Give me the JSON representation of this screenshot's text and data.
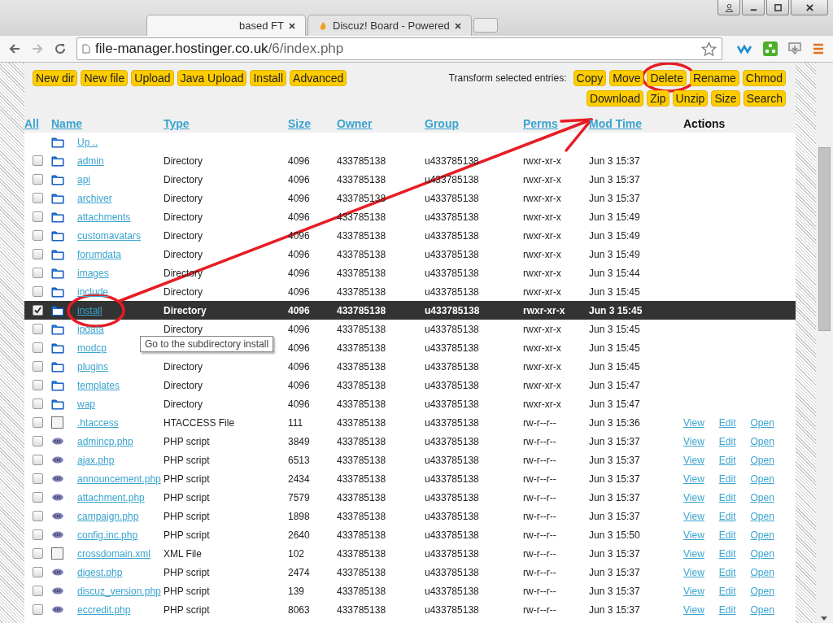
{
  "browser": {
    "tabs": [
      {
        "label": "based FT",
        "selected": true
      },
      {
        "label": "Discuz! Board - Powered",
        "selected": false
      }
    ],
    "url": {
      "host": "file-manager.hostinger.co.uk",
      "path": "/6/index.php"
    }
  },
  "toolbar": {
    "buttons": [
      "New dir",
      "New file",
      "Upload",
      "Java Upload",
      "Install",
      "Advanced"
    ],
    "transform_label": "Transform selected entries:",
    "transform_buttons": [
      [
        "Copy",
        "Move",
        "Delete",
        "Rename",
        "Chmod"
      ],
      [
        "Download",
        "Zip",
        "Unzip",
        "Size",
        "Search"
      ]
    ]
  },
  "table": {
    "columns": [
      "All",
      "Name",
      "Type",
      "Size",
      "Owner",
      "Group",
      "Perms",
      "Mod Time",
      "Actions"
    ],
    "parent_link": "Up ..",
    "rows": [
      {
        "kind": "folder",
        "checked": false,
        "name": "admin",
        "type": "Directory",
        "size": "4096",
        "owner": "433785138",
        "group": "u433785138",
        "perms": "rwxr-xr-x",
        "mtime": "Jun 3 15:37",
        "actions": []
      },
      {
        "kind": "folder",
        "checked": false,
        "name": "api",
        "type": "Directory",
        "size": "4096",
        "owner": "433785138",
        "group": "u433785138",
        "perms": "rwxr-xr-x",
        "mtime": "Jun 3 15:37",
        "actions": []
      },
      {
        "kind": "folder",
        "checked": false,
        "name": "archiver",
        "type": "Directory",
        "size": "4096",
        "owner": "433785138",
        "group": "u433785138",
        "perms": "rwxr-xr-x",
        "mtime": "Jun 3 15:37",
        "actions": []
      },
      {
        "kind": "folder",
        "checked": false,
        "name": "attachments",
        "type": "Directory",
        "size": "4096",
        "owner": "433785138",
        "group": "u433785138",
        "perms": "rwxr-xr-x",
        "mtime": "Jun 3 15:49",
        "actions": []
      },
      {
        "kind": "folder",
        "checked": false,
        "name": "customavatars",
        "type": "Directory",
        "size": "4096",
        "owner": "433785138",
        "group": "u433785138",
        "perms": "rwxr-xr-x",
        "mtime": "Jun 3 15:49",
        "actions": []
      },
      {
        "kind": "folder",
        "checked": false,
        "name": "forumdata",
        "type": "Directory",
        "size": "4096",
        "owner": "433785138",
        "group": "u433785138",
        "perms": "rwxr-xr-x",
        "mtime": "Jun 3 15:49",
        "actions": []
      },
      {
        "kind": "folder",
        "checked": false,
        "name": "images",
        "type": "Directory",
        "size": "4096",
        "owner": "433785138",
        "group": "u433785138",
        "perms": "rwxr-xr-x",
        "mtime": "Jun 3 15:44",
        "actions": []
      },
      {
        "kind": "folder",
        "checked": false,
        "name": "include",
        "type": "Directory",
        "size": "4096",
        "owner": "433785138",
        "group": "u433785138",
        "perms": "rwxr-xr-x",
        "mtime": "Jun 3 15:45",
        "actions": []
      },
      {
        "kind": "folder",
        "checked": true,
        "name": "install",
        "type": "Directory",
        "size": "4096",
        "owner": "433785138",
        "group": "u433785138",
        "perms": "rwxr-xr-x",
        "mtime": "Jun 3 15:45",
        "actions": []
      },
      {
        "kind": "folder",
        "checked": false,
        "name": "ipdata",
        "type": "Directory",
        "size": "4096",
        "owner": "433785138",
        "group": "u433785138",
        "perms": "rwxr-xr-x",
        "mtime": "Jun 3 15:45",
        "actions": []
      },
      {
        "kind": "folder",
        "checked": false,
        "name": "modcp",
        "size": "4096",
        "owner": "433785138",
        "group": "u433785138",
        "perms": "rwxr-xr-x",
        "mtime": "Jun 3 15:45",
        "actions": []
      },
      {
        "kind": "folder",
        "checked": false,
        "name": "plugins",
        "type": "Directory",
        "size": "4096",
        "owner": "433785138",
        "group": "u433785138",
        "perms": "rwxr-xr-x",
        "mtime": "Jun 3 15:45",
        "actions": []
      },
      {
        "kind": "folder",
        "checked": false,
        "name": "templates",
        "type": "Directory",
        "size": "4096",
        "owner": "433785138",
        "group": "u433785138",
        "perms": "rwxr-xr-x",
        "mtime": "Jun 3 15:47",
        "actions": []
      },
      {
        "kind": "folder",
        "checked": false,
        "name": "wap",
        "type": "Directory",
        "size": "4096",
        "owner": "433785138",
        "group": "u433785138",
        "perms": "rwxr-xr-x",
        "mtime": "Jun 3 15:47",
        "actions": []
      },
      {
        "kind": "file",
        "checked": false,
        "name": ".htaccess",
        "type": "HTACCESS File",
        "size": "111",
        "owner": "433785138",
        "group": "u433785138",
        "perms": "rw-r--r--",
        "mtime": "Jun 3 15:36",
        "actions": [
          "View",
          "Edit",
          "Open"
        ]
      },
      {
        "kind": "php",
        "checked": false,
        "name": "admincp.php",
        "type": "PHP script",
        "size": "3849",
        "owner": "433785138",
        "group": "u433785138",
        "perms": "rw-r--r--",
        "mtime": "Jun 3 15:37",
        "actions": [
          "View",
          "Edit",
          "Open"
        ]
      },
      {
        "kind": "php",
        "checked": false,
        "name": "ajax.php",
        "type": "PHP script",
        "size": "6513",
        "owner": "433785138",
        "group": "u433785138",
        "perms": "rw-r--r--",
        "mtime": "Jun 3 15:37",
        "actions": [
          "View",
          "Edit",
          "Open"
        ]
      },
      {
        "kind": "php",
        "checked": false,
        "name": "announcement.php",
        "type": "PHP script",
        "size": "2434",
        "owner": "433785138",
        "group": "u433785138",
        "perms": "rw-r--r--",
        "mtime": "Jun 3 15:37",
        "actions": [
          "View",
          "Edit",
          "Open"
        ]
      },
      {
        "kind": "php",
        "checked": false,
        "name": "attachment.php",
        "type": "PHP script",
        "size": "7579",
        "owner": "433785138",
        "group": "u433785138",
        "perms": "rw-r--r--",
        "mtime": "Jun 3 15:37",
        "actions": [
          "View",
          "Edit",
          "Open"
        ]
      },
      {
        "kind": "php",
        "checked": false,
        "name": "campaign.php",
        "type": "PHP script",
        "size": "1898",
        "owner": "433785138",
        "group": "u433785138",
        "perms": "rw-r--r--",
        "mtime": "Jun 3 15:37",
        "actions": [
          "View",
          "Edit",
          "Open"
        ]
      },
      {
        "kind": "php",
        "checked": false,
        "name": "config.inc.php",
        "type": "PHP script",
        "size": "2640",
        "owner": "433785138",
        "group": "u433785138",
        "perms": "rw-r--r--",
        "mtime": "Jun 3 15:50",
        "actions": [
          "View",
          "Edit",
          "Open"
        ]
      },
      {
        "kind": "file",
        "checked": false,
        "name": "crossdomain.xml",
        "type": "XML File",
        "size": "102",
        "owner": "433785138",
        "group": "u433785138",
        "perms": "rw-r--r--",
        "mtime": "Jun 3 15:37",
        "actions": [
          "View",
          "Edit",
          "Open"
        ]
      },
      {
        "kind": "php",
        "checked": false,
        "name": "digest.php",
        "type": "PHP script",
        "size": "2474",
        "owner": "433785138",
        "group": "u433785138",
        "perms": "rw-r--r--",
        "mtime": "Jun 3 15:37",
        "actions": [
          "View",
          "Edit",
          "Open"
        ]
      },
      {
        "kind": "php",
        "checked": false,
        "name": "discuz_version.php",
        "type": "PHP script",
        "size": "139",
        "owner": "433785138",
        "group": "u433785138",
        "perms": "rw-r--r--",
        "mtime": "Jun 3 15:37",
        "actions": [
          "View",
          "Edit",
          "Open"
        ]
      },
      {
        "kind": "php",
        "checked": false,
        "name": "eccredit.php",
        "type": "PHP script",
        "size": "8063",
        "owner": "433785138",
        "group": "u433785138",
        "perms": "rw-r--r--",
        "mtime": "Jun 3 15:37",
        "actions": [
          "View",
          "Edit",
          "Open"
        ]
      }
    ]
  },
  "tooltip": "Go to the subdirectory install"
}
